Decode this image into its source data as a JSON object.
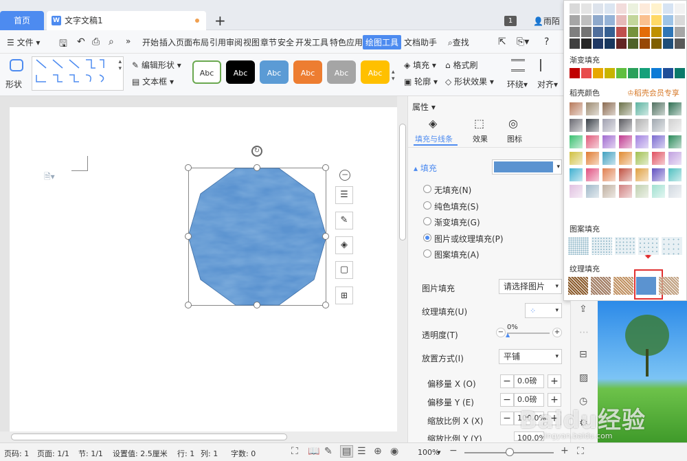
{
  "tabs": {
    "home": "首页",
    "doc": "文字文稿1"
  },
  "topbar": {
    "badge": "1",
    "user": "雨陌"
  },
  "menu": {
    "file": "文件",
    "items": [
      "开始",
      "插入",
      "页面布局",
      "引用",
      "审阅",
      "视图",
      "章节",
      "安全",
      "开发工具",
      "特色应用"
    ],
    "active": "绘图工具",
    "assistant": "文档助手",
    "search": "查找"
  },
  "ribbon": {
    "shape": "形状",
    "edit_shape": "编辑形状",
    "textbox": "文本框",
    "abc": "Abc",
    "fill": "填充",
    "format_brush": "格式刷",
    "outline": "轮廓",
    "shape_effect": "形状效果",
    "wrap": "环绕",
    "align": "对齐"
  },
  "abc_styles": [
    {
      "bg": "#ffffff",
      "fg": "#333333",
      "border": "#6aa84f"
    },
    {
      "bg": "#000000",
      "fg": "#ffffff",
      "border": "#000000"
    },
    {
      "bg": "#5b9bd5",
      "fg": "#ffffff",
      "border": "#5b9bd5"
    },
    {
      "bg": "#ed7d31",
      "fg": "#ffffff",
      "border": "#ed7d31"
    },
    {
      "bg": "#a5a5a5",
      "fg": "#ffffff",
      "border": "#a5a5a5"
    },
    {
      "bg": "#ffc000",
      "fg": "#ffffff",
      "border": "#ffc000"
    }
  ],
  "props": {
    "title": "属性",
    "tabs": [
      "填充与线条",
      "效果",
      "图标"
    ],
    "fill_label": "填充",
    "options": [
      "无填充(N)",
      "纯色填充(S)",
      "渐变填充(G)",
      "图片或纹理填充(P)",
      "图案填充(A)"
    ],
    "selected_option": 3,
    "picture_fill": "图片填充",
    "picture_fill_value": "请选择图片",
    "texture_fill": "纹理填充(U)",
    "transparency": "透明度(T)",
    "transparency_value": "0%",
    "placement": "放置方式(I)",
    "placement_value": "平铺",
    "offset_x": "偏移量 X (O)",
    "offset_x_value": "0.0磅",
    "offset_y": "偏移量 Y (E)",
    "offset_y_value": "0.0磅",
    "scale_x": "缩放比例 X (X)",
    "scale_x_value": "100.0%",
    "scale_y": "缩放比例 Y (Y)",
    "scale_y_value": "100.0%"
  },
  "popup": {
    "gradient": "渐变填充",
    "daoke": "稻壳颜色",
    "member": "稻壳会员专享",
    "pattern": "图案填充",
    "texture": "纹理填充"
  },
  "status": {
    "page_no": "页码: 1",
    "pages": "页面: 1/1",
    "section": "节: 1/1",
    "setting": "设置值: 2.5厘米",
    "row": "行: 1",
    "col": "列: 1",
    "words": "字数: 0",
    "zoom": "100%"
  },
  "watermark": {
    "brand": "Baidu经验",
    "url": "jingyan.baidu.com"
  },
  "colors": {
    "accent": "#4d8bf0",
    "shape": "#5b93d0",
    "highlight": "#e03030"
  }
}
